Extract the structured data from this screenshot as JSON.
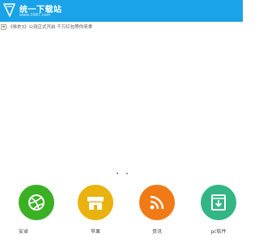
{
  "header": {
    "background": "#1aa3e8",
    "logo_title": "统一下载站",
    "logo_url": "www.3987.com"
  },
  "banner": {
    "text": "《咏史3》公测正式开启 千万红包等你来拿"
  },
  "carousel": {
    "dot_count": 2
  },
  "nav": {
    "items": [
      {
        "label": "安卓",
        "icon": "android-ball-icon",
        "color": "#3bb025"
      },
      {
        "label": "苹果",
        "icon": "apple-store-icon",
        "color": "#e9b20e"
      },
      {
        "label": "资讯",
        "icon": "rss-icon",
        "color": "#f07a16"
      },
      {
        "label": "pc软件",
        "icon": "pc-software-icon",
        "color": "#33b585"
      }
    ]
  }
}
